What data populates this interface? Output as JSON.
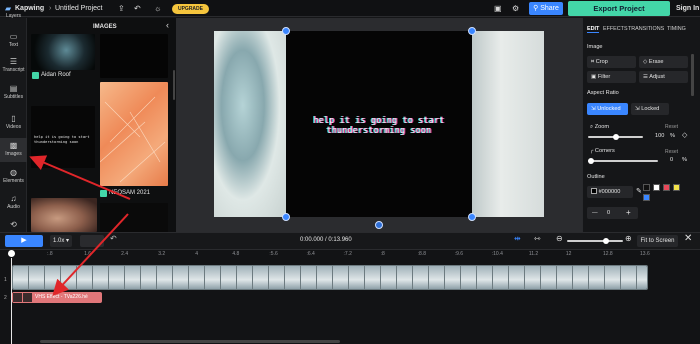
{
  "topbar": {
    "app_name": "Kapwing",
    "separator": "›",
    "project_name": "Untitled Project",
    "upgrade_label": "UPGRADE",
    "share_label": "Share",
    "export_label": "Export Project",
    "signin_label": "Sign In"
  },
  "rail": [
    {
      "label": "Layers"
    },
    {
      "label": "Text"
    },
    {
      "label": "Transcript"
    },
    {
      "label": "Subtitles"
    },
    {
      "label": "Videos"
    },
    {
      "label": "Images"
    },
    {
      "label": "Elements"
    },
    {
      "label": "Audio"
    }
  ],
  "panel": {
    "title": "IMAGES",
    "items": [
      {
        "caption": "Aidan Roof"
      },
      {
        "caption": "help it is going to start thunderstorming soon"
      },
      {
        "caption": "NEOSAM 2021"
      }
    ]
  },
  "canvas": {
    "caption_line1": "help it is going to start",
    "caption_line2": "thunderstorming soon"
  },
  "right_panel": {
    "tabs": [
      "EDIT",
      "EFFECTS",
      "TRANSITIONS",
      "TIMING"
    ],
    "image_heading": "Image",
    "buttons": [
      "Crop",
      "Erase",
      "Filter",
      "Adjust"
    ],
    "aspect_heading": "Aspect Ratio",
    "aspect_options": [
      "Unlocked",
      "Locked"
    ],
    "zoom_label": "Zoom",
    "zoom_reset": "Reset",
    "zoom_value": "100",
    "zoom_unit": "%",
    "zoom_level": 0.5,
    "corners_label": "Corners",
    "corners_reset": "Reset",
    "corners_value": "0",
    "corners_unit": "%",
    "corners_level": 0,
    "outline_heading": "Outline",
    "outline_color": "#000000",
    "outline_width": "0",
    "swatches": [
      "#111111",
      "#ffffff",
      "#e8495a",
      "#f2e24a",
      "#3a86ff"
    ]
  },
  "playback": {
    "speed": "1.0x",
    "time": "0:00.000 / 0:13.960",
    "fit_label": "Fit to Screen"
  },
  "timeline": {
    "ticks": [
      ":0",
      ":.8",
      "1.6",
      "2.4",
      "3.2",
      "4",
      "4.8",
      ":5.6",
      ":6.4",
      ":7.2",
      ":8",
      ":8.8",
      ":9.6",
      ":10.4",
      "11.2",
      "12",
      "12.8",
      "13.6"
    ],
    "track_numbers": [
      "1",
      "2"
    ],
    "clip_label": "VHS Effect - TVa226.hé"
  },
  "colors": {
    "accent": "#3a86ff",
    "export": "#43d6a8",
    "upgrade": "#f5c53d",
    "annotation_arrow": "#e0262a"
  }
}
